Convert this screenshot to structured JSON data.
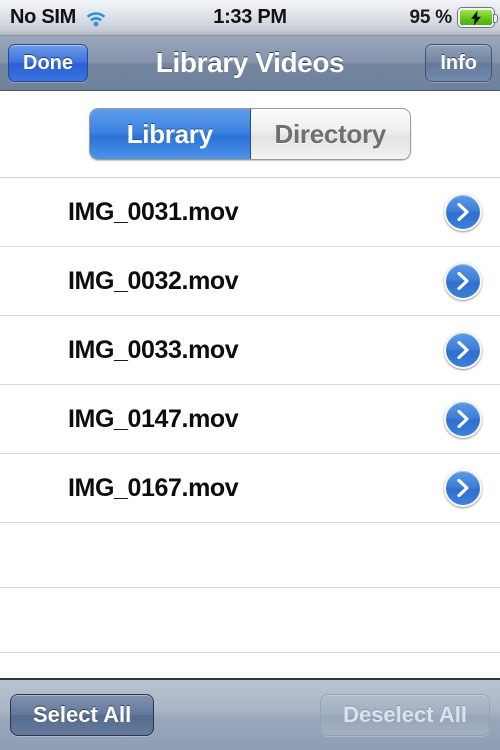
{
  "status_bar": {
    "carrier": "No SIM",
    "wifi_icon": "wifi-icon",
    "time": "1:33 PM",
    "battery_percent": "95 %",
    "battery_icon": "battery-charging-icon"
  },
  "nav_bar": {
    "left_button": "Done",
    "title": "Library Videos",
    "right_button": "Info"
  },
  "segmented_control": {
    "selected": "Library",
    "segments": [
      {
        "label": "Library",
        "selected": true
      },
      {
        "label": "Directory",
        "selected": false
      }
    ]
  },
  "table": {
    "rows": [
      {
        "label": "IMG_0031.mov",
        "accessory": "detail-disclosure-icon"
      },
      {
        "label": "IMG_0032.mov",
        "accessory": "detail-disclosure-icon"
      },
      {
        "label": "IMG_0033.mov",
        "accessory": "detail-disclosure-icon"
      },
      {
        "label": "IMG_0147.mov",
        "accessory": "detail-disclosure-icon"
      },
      {
        "label": "IMG_0167.mov",
        "accessory": "detail-disclosure-icon"
      }
    ],
    "empty_row_count": 2
  },
  "toolbar": {
    "select_all_label": "Select All",
    "deselect_all_label": "Deselect All",
    "select_all_enabled": true,
    "deselect_all_enabled": false
  },
  "colors": {
    "accent_blue": "#2f72d8",
    "done_blue": "#3d70dd",
    "nav_bar": "#7a8ca6",
    "toolbar": "#9aa7bb",
    "battery_green": "#63c71c",
    "row_separator": "#dcdcdc"
  }
}
